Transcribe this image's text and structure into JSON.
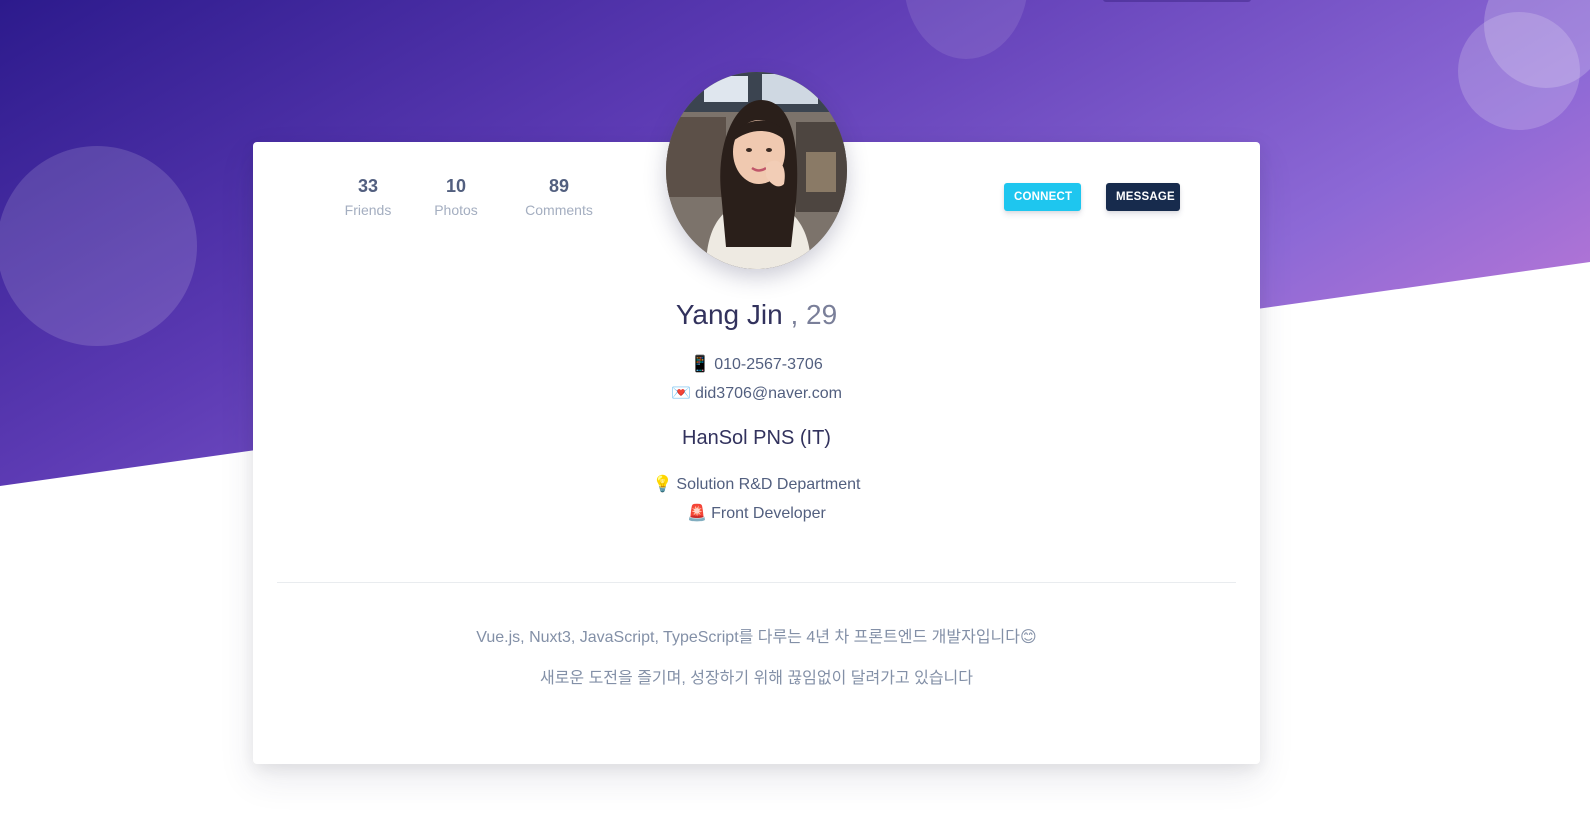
{
  "stats": [
    {
      "value": "33",
      "label": "Friends"
    },
    {
      "value": "10",
      "label": "Photos"
    },
    {
      "value": "89",
      "label": "Comments"
    }
  ],
  "actions": {
    "connect_label": "CONNECT",
    "message_label": "MESSAGE"
  },
  "profile": {
    "name": "Yang Jin",
    "age": ", 29",
    "phone_icon": "📱",
    "phone": "010-2567-3706",
    "email_icon": "💌",
    "email": "did3706@naver.com",
    "company": "HanSol PNS (IT)",
    "department_icon": "💡",
    "department": "Solution R&D Department",
    "role_icon": "🚨",
    "role": "Front Developer"
  },
  "bio": {
    "line1": "Vue.js, Nuxt3, JavaScript, TypeScript를 다루는 4년 차 프론트엔드 개발자입니다😊",
    "line2": "새로운 도전을 즐기며, 성장하기 위해 끊임없이 달려가고 있습니다"
  },
  "colors": {
    "connect": "#1ec6ef",
    "message": "#172b4d",
    "hero_start": "#2c1a8c",
    "hero_end": "#d37fd6"
  }
}
